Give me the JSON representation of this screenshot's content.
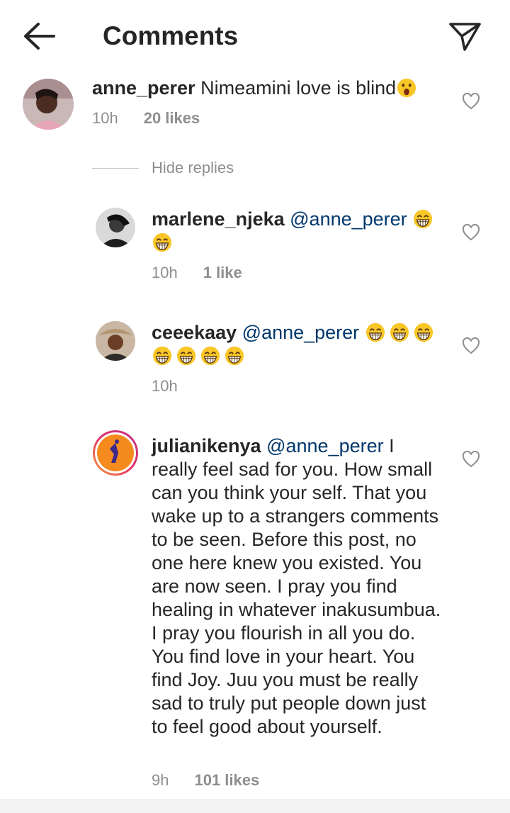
{
  "header": {
    "title": "Comments"
  },
  "main_comment": {
    "username": "anne_perer",
    "text": "Nimeamini love is blind",
    "emoji": "astonished",
    "time": "10h",
    "likes": "20 likes"
  },
  "hide_replies": "Hide replies",
  "replies": [
    {
      "username": "marlene_njeka",
      "mention": "@anne_perer",
      "text": "",
      "time": "10h",
      "likes": "1 like",
      "emoji_count": 2
    },
    {
      "username": "ceeekaay",
      "mention": "@anne_perer",
      "text": "",
      "time": "10h",
      "likes": "",
      "emoji_count": 7
    },
    {
      "username": "julianikenya",
      "mention": "@anne_perer",
      "text": "I really feel sad for you. How small can you think your self.  That you wake up to a strangers comments to be seen. Before this post, no one here knew you existed. You are now seen. I pray you find healing in whatever inakusumbua. I pray you flourish in all you do. You find love in your heart. You find Joy. Juu you must be really sad to truly put people down just to feel good about yourself.",
      "time": "9h",
      "likes": "101 likes",
      "emoji_count": 0
    }
  ],
  "colors": {
    "mention": "#00376b",
    "meta": "#8e8e8e",
    "text": "#262626"
  }
}
